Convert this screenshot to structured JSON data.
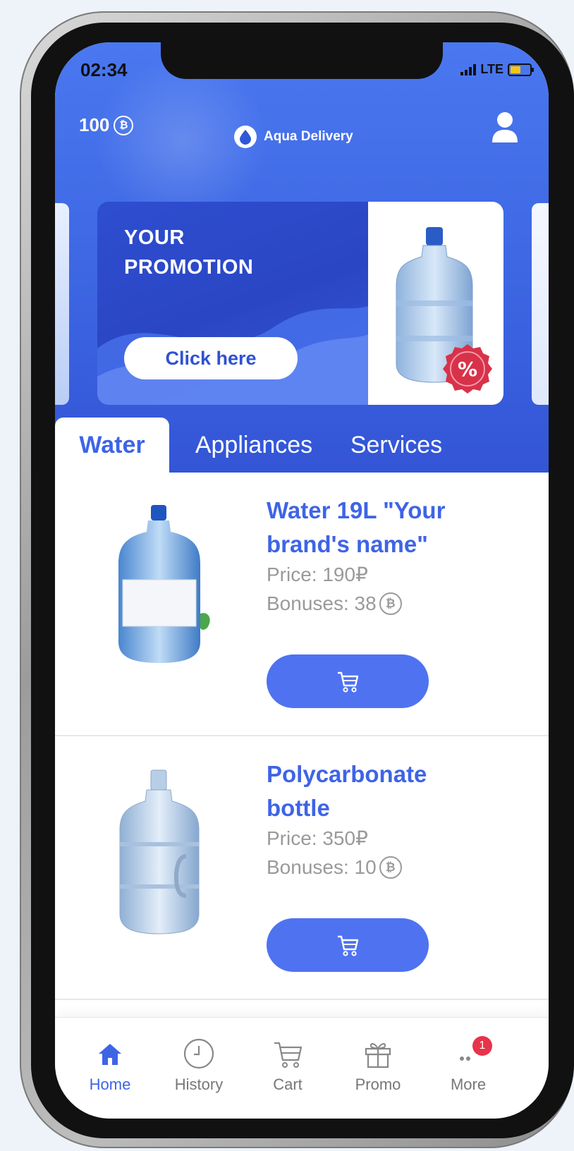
{
  "status_bar": {
    "time": "02:34",
    "network": "LTE"
  },
  "header": {
    "balance": "100",
    "coin_symbol": "₿",
    "app_name": "Aqua Delivery"
  },
  "promo": {
    "title_line1": "YOUR",
    "title_line2": "PROMOTION",
    "button_label": "Click here",
    "badge": "%"
  },
  "category_tabs": [
    {
      "label": "Water",
      "active": true
    },
    {
      "label": "Appliances",
      "active": false
    },
    {
      "label": "Services",
      "active": false
    }
  ],
  "products": [
    {
      "name": "Water 19L \"Your brand's name\"",
      "price": "Price: 190₽",
      "bonuses_label": "Bonuses: 38",
      "coin_symbol": "₿"
    },
    {
      "name": "Polycarbonate bottle",
      "price": "Price: 350₽",
      "bonuses_label": "Bonuses: 10",
      "coin_symbol": "₿"
    }
  ],
  "bottom_nav": [
    {
      "label": "Home",
      "icon": "home-icon",
      "active": true
    },
    {
      "label": "History",
      "icon": "clock-icon",
      "active": false
    },
    {
      "label": "Cart",
      "icon": "cart-icon",
      "active": false
    },
    {
      "label": "Promo",
      "icon": "gift-icon",
      "active": false
    },
    {
      "label": "More",
      "icon": "more-icon",
      "active": false,
      "badge": "1"
    }
  ],
  "colors": {
    "accent": "#3e64e6",
    "button": "#4f72f1",
    "hero": "#3d66e3",
    "badge": "#e8334a"
  }
}
